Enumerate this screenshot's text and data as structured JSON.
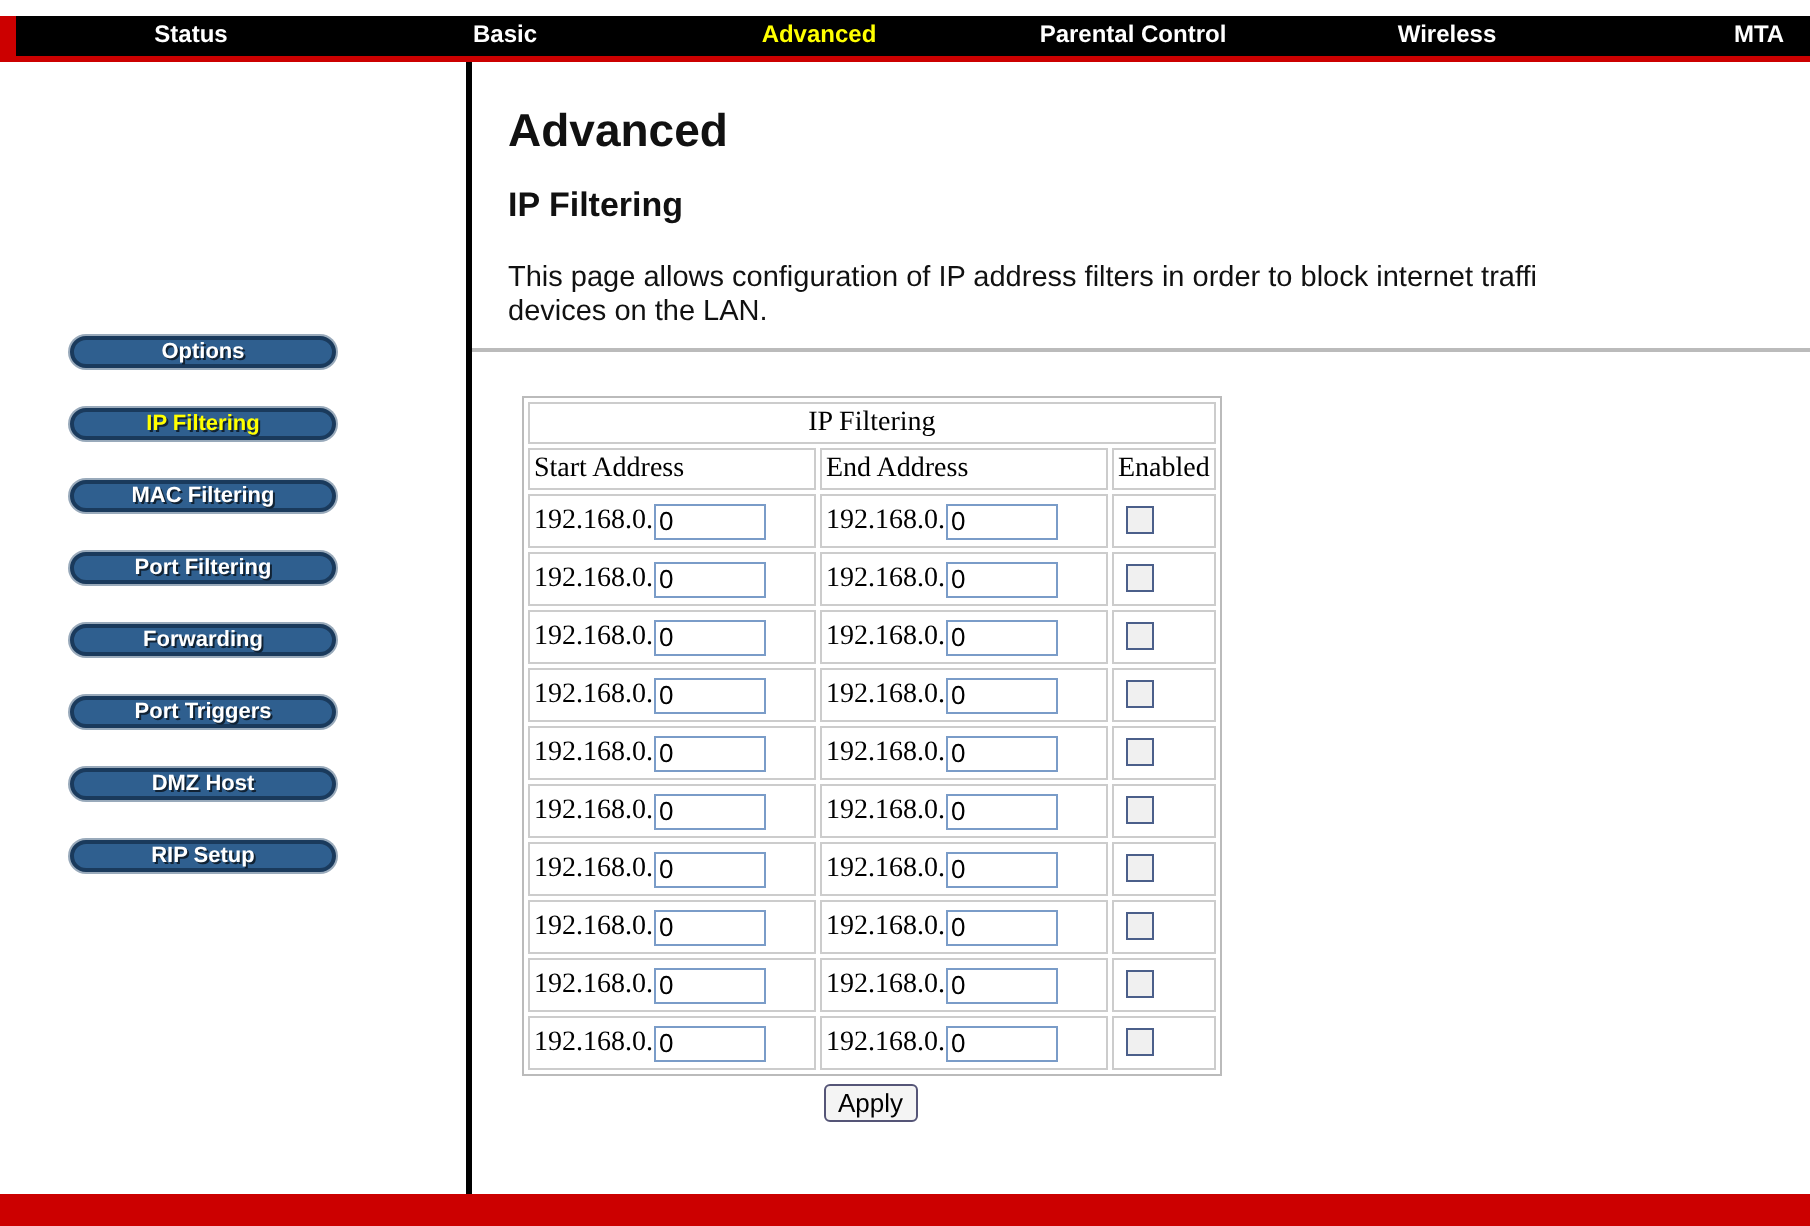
{
  "nav": [
    {
      "label": "Status",
      "selected": false
    },
    {
      "label": "Basic",
      "selected": false
    },
    {
      "label": "Advanced",
      "selected": true
    },
    {
      "label": "Parental Control",
      "selected": false
    },
    {
      "label": "Wireless",
      "selected": false
    },
    {
      "label": "MTA",
      "selected": false
    }
  ],
  "sidebar": {
    "items": [
      {
        "label": "Options",
        "selected": false
      },
      {
        "label": "IP Filtering",
        "selected": true
      },
      {
        "label": "MAC Filtering",
        "selected": false
      },
      {
        "label": "Port Filtering",
        "selected": false
      },
      {
        "label": "Forwarding",
        "selected": false
      },
      {
        "label": "Port Triggers",
        "selected": false
      },
      {
        "label": "DMZ Host",
        "selected": false
      },
      {
        "label": "RIP Setup",
        "selected": false
      }
    ]
  },
  "page_title": "Advanced",
  "section_title": "IP Filtering",
  "description": [
    "This page allows configuration of IP address filters in order to block internet traffi",
    "devices on the LAN."
  ],
  "table": {
    "title": "IP Filtering",
    "columns": [
      "Start Address",
      "End Address",
      "Enabled"
    ],
    "rows": [
      {
        "start_prefix": "192.168.0.",
        "start_value": "0",
        "end_prefix": "192.168.0.",
        "end_value": "0",
        "enabled": false
      },
      {
        "start_prefix": "192.168.0.",
        "start_value": "0",
        "end_prefix": "192.168.0.",
        "end_value": "0",
        "enabled": false
      },
      {
        "start_prefix": "192.168.0.",
        "start_value": "0",
        "end_prefix": "192.168.0.",
        "end_value": "0",
        "enabled": false
      },
      {
        "start_prefix": "192.168.0.",
        "start_value": "0",
        "end_prefix": "192.168.0.",
        "end_value": "0",
        "enabled": false
      },
      {
        "start_prefix": "192.168.0.",
        "start_value": "0",
        "end_prefix": "192.168.0.",
        "end_value": "0",
        "enabled": false
      },
      {
        "start_prefix": "192.168.0.",
        "start_value": "0",
        "end_prefix": "192.168.0.",
        "end_value": "0",
        "enabled": false
      },
      {
        "start_prefix": "192.168.0.",
        "start_value": "0",
        "end_prefix": "192.168.0.",
        "end_value": "0",
        "enabled": false
      },
      {
        "start_prefix": "192.168.0.",
        "start_value": "0",
        "end_prefix": "192.168.0.",
        "end_value": "0",
        "enabled": false
      },
      {
        "start_prefix": "192.168.0.",
        "start_value": "0",
        "end_prefix": "192.168.0.",
        "end_value": "0",
        "enabled": false
      },
      {
        "start_prefix": "192.168.0.",
        "start_value": "0",
        "end_prefix": "192.168.0.",
        "end_value": "0",
        "enabled": false
      }
    ]
  },
  "apply_button": "Apply"
}
